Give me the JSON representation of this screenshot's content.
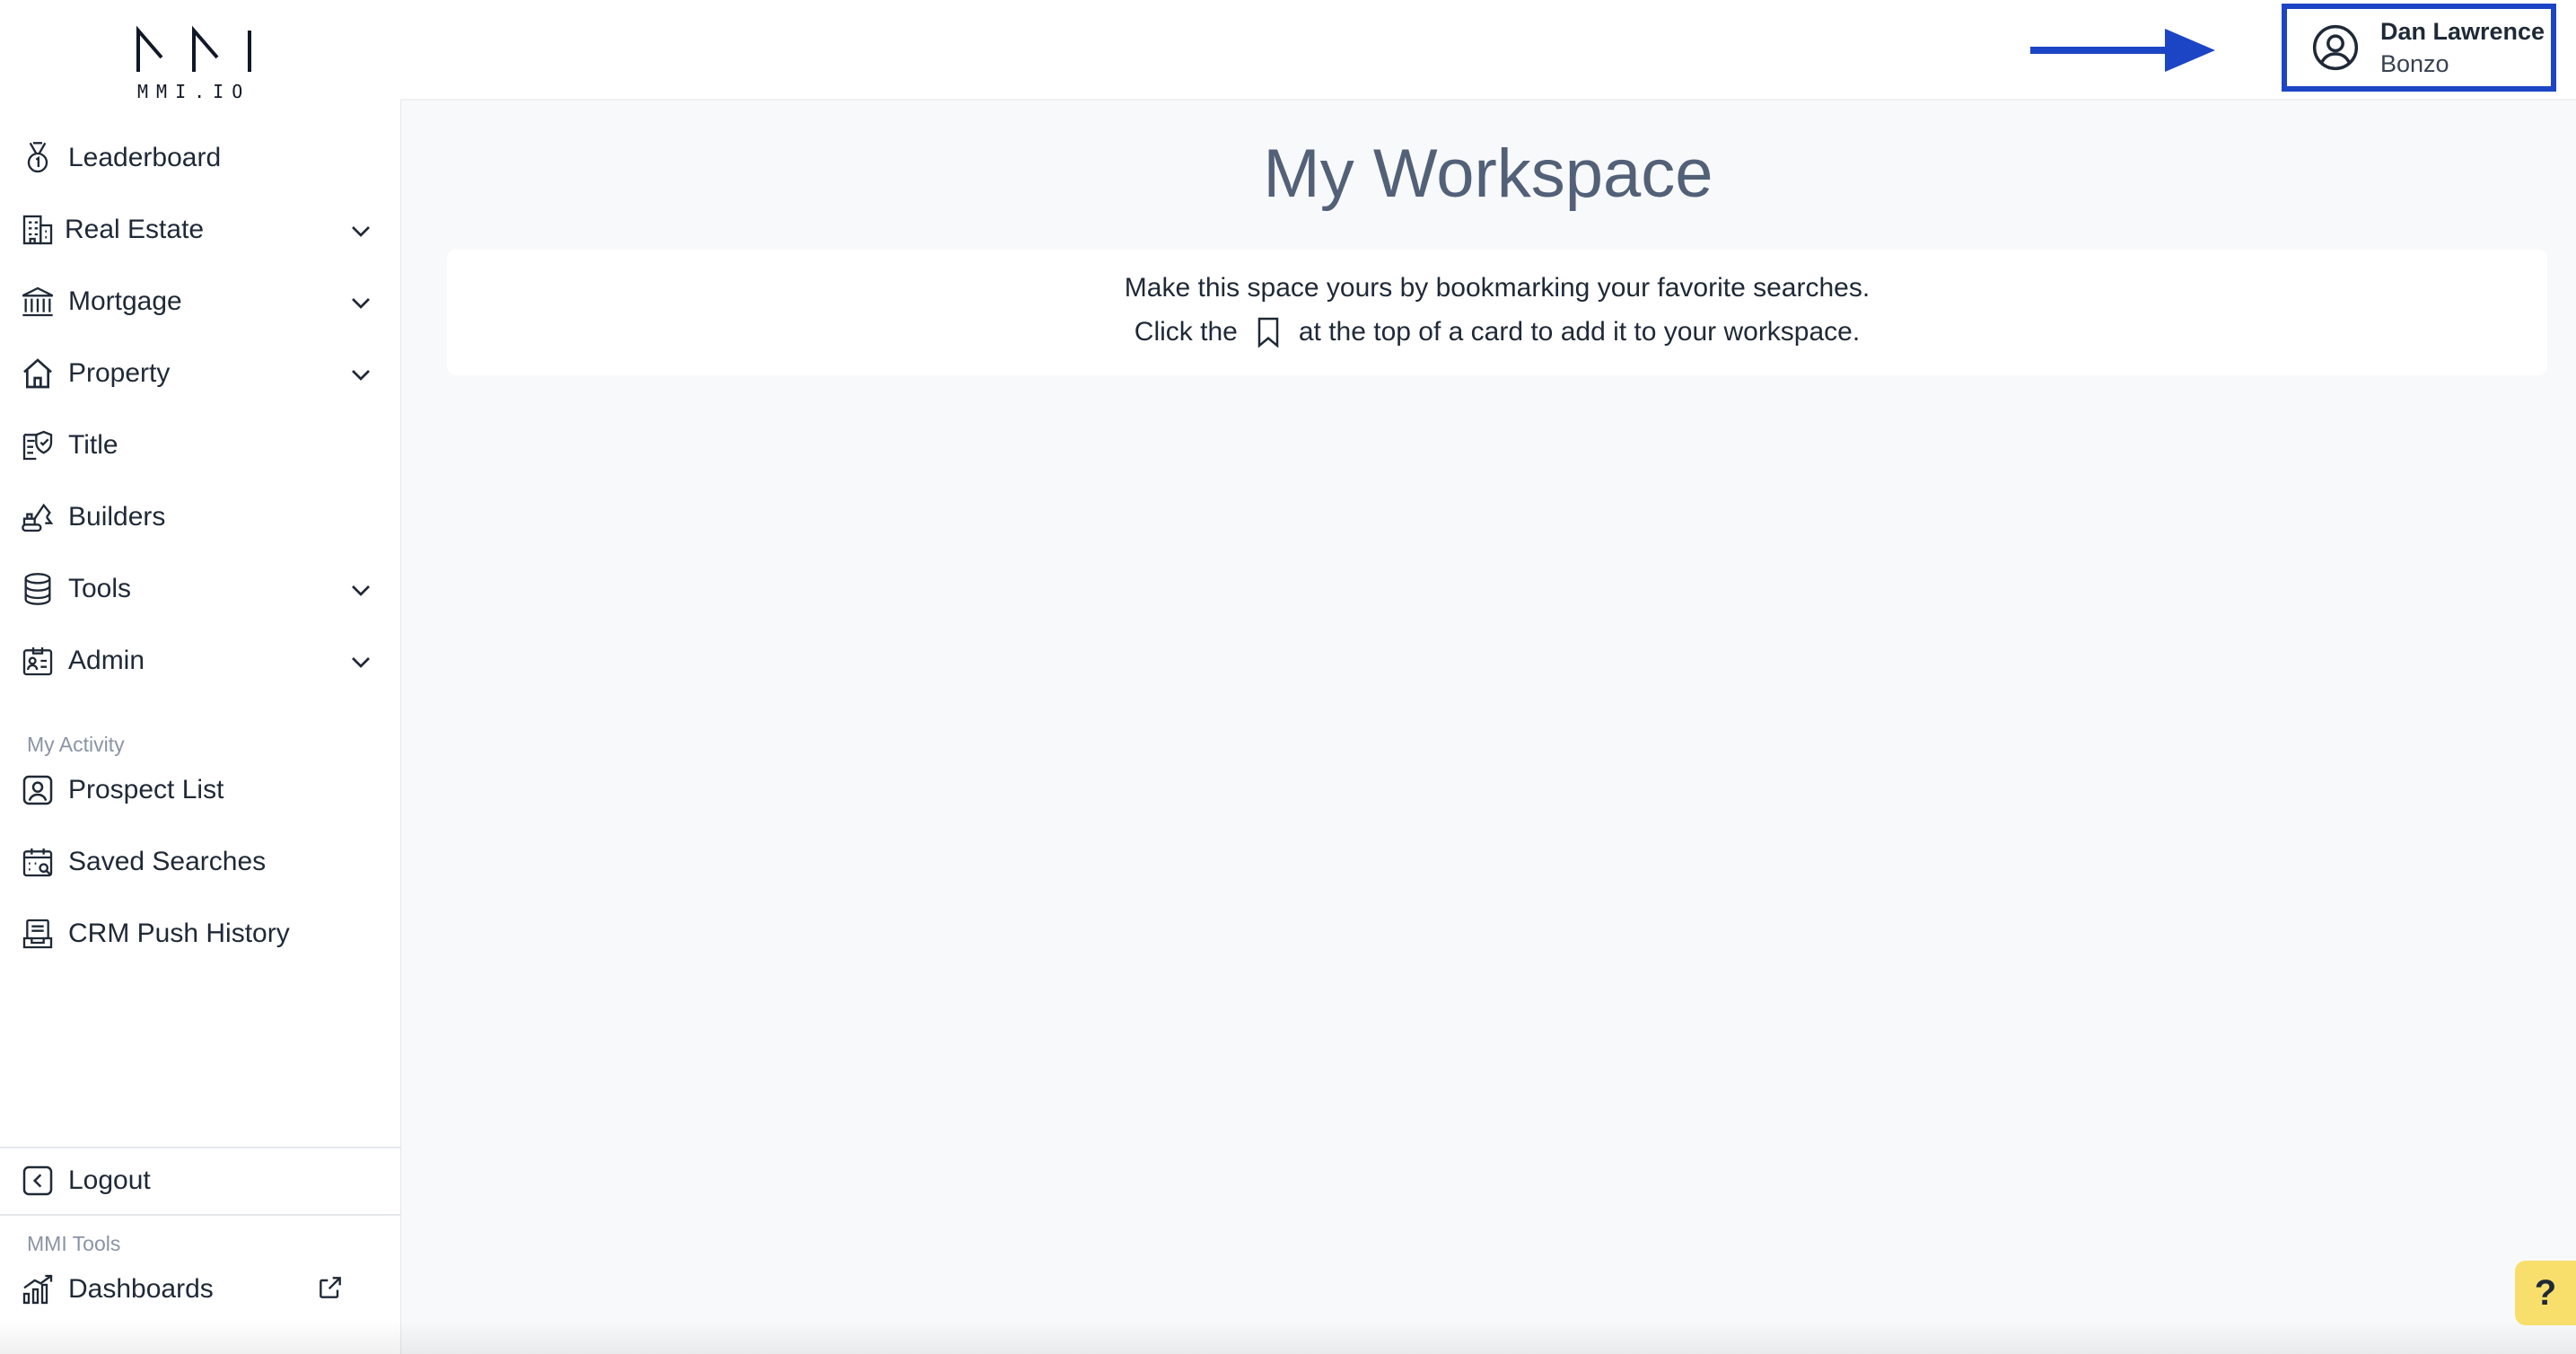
{
  "brand": {
    "logo_text": "MMI.IO"
  },
  "sidebar": {
    "items": [
      {
        "label": "Leaderboard",
        "icon": "medal-icon",
        "expandable": false
      },
      {
        "label": "Real Estate",
        "icon": "building-icon",
        "expandable": true
      },
      {
        "label": "Mortgage",
        "icon": "bank-icon",
        "expandable": true
      },
      {
        "label": "Property",
        "icon": "home-icon",
        "expandable": true
      },
      {
        "label": "Title",
        "icon": "title-shield-icon",
        "expandable": false
      },
      {
        "label": "Builders",
        "icon": "excavator-icon",
        "expandable": false
      },
      {
        "label": "Tools",
        "icon": "database-icon",
        "expandable": true
      },
      {
        "label": "Admin",
        "icon": "id-card-icon",
        "expandable": true
      }
    ],
    "activity_label": "My Activity",
    "activity_items": [
      {
        "label": "Prospect List",
        "icon": "user-square-icon"
      },
      {
        "label": "Saved Searches",
        "icon": "calendar-search-icon"
      },
      {
        "label": "CRM Push History",
        "icon": "inbox-upload-icon"
      }
    ],
    "logout_label": "Logout",
    "tools_label": "MMI Tools",
    "dashboards_label": "Dashboards"
  },
  "header": {
    "user_name": "Dan Lawrence",
    "user_org": "Bonzo",
    "highlight_color": "#1c45c6"
  },
  "main": {
    "title": "My Workspace",
    "info_line1": "Make this space yours by bookmarking your favorite searches.",
    "info_line2_before": "Click the",
    "info_line2_after": "at the top of a card to add it to your workspace."
  },
  "help": {
    "label": "?"
  },
  "colors": {
    "accent": "#1c45c6",
    "title": "#526178",
    "help_bg": "#f8df6c"
  }
}
